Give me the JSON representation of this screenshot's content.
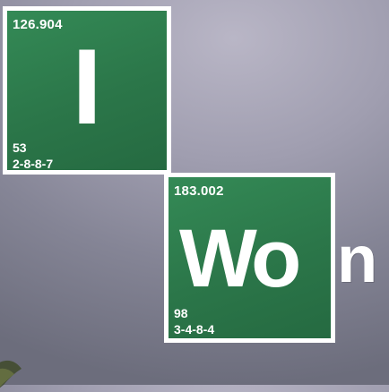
{
  "tiles": [
    {
      "mass": "126.904",
      "symbol": "I",
      "number": "53",
      "config": "2-8-8-7"
    },
    {
      "mass": "183.002",
      "symbol": "Wo",
      "number": "98",
      "config": "3-4-8-4"
    }
  ],
  "trailing_text": "n",
  "colors": {
    "tile_green": "#2e7d4d",
    "tile_border": "#ffffff",
    "background": "#9a98aa",
    "text": "#ffffff"
  }
}
